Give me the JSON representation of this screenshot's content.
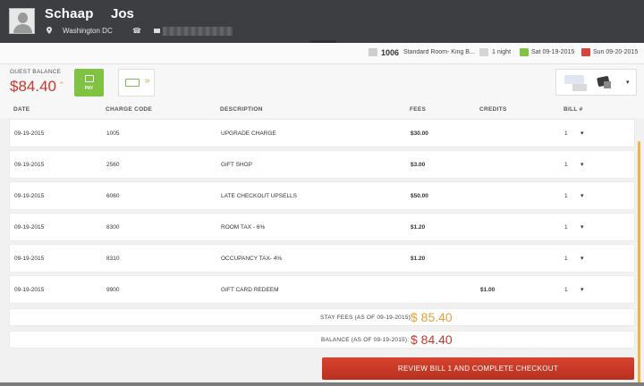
{
  "guest": {
    "first_name": "Schaap",
    "last_name": "Jos",
    "location": "Washington DC"
  },
  "reservation": {
    "room_number": "1006",
    "room_type": "Standard Room- King B...",
    "nights": "1 night",
    "arrival": "Sat 09-19-2015",
    "departure": "Sun 09-20-2015"
  },
  "balance": {
    "label": "GUEST BALANCE",
    "value": "$84.40",
    "pay_label": "PAY"
  },
  "table": {
    "headers": {
      "date": "DATE",
      "charge_code": "CHARGE CODE",
      "description": "DESCRIPTION",
      "fees": "FEES",
      "credits": "CREDITS",
      "bill": "BILL #"
    },
    "rows": [
      {
        "date": "09-19-2015",
        "code": "1005",
        "description": "UPGRADE CHARGE",
        "fees": "$30.00",
        "credits": "",
        "bill": "1"
      },
      {
        "date": "09-19-2015",
        "code": "2560",
        "description": "GIFT SHOP",
        "fees": "$3.00",
        "credits": "",
        "bill": "1"
      },
      {
        "date": "09-19-2015",
        "code": "6060",
        "description": "LATE CHECKOUT UPSELLS",
        "fees": "$50.00",
        "credits": "",
        "bill": "1"
      },
      {
        "date": "09-19-2015",
        "code": "8300",
        "description": "ROOM TAX - 6%",
        "fees": "$1.20",
        "credits": "",
        "bill": "1"
      },
      {
        "date": "09-19-2015",
        "code": "8310",
        "description": "OCCUPANCY TAX- 4%",
        "fees": "$1.20",
        "credits": "",
        "bill": "1"
      },
      {
        "date": "09-19-2015",
        "code": "9900",
        "description": "GIFT CARD REDEEM",
        "fees": "",
        "credits": "$1.00",
        "bill": "1"
      }
    ]
  },
  "totals": {
    "stay_fees_label": "STAY FEES (AS OF 09-19-2015):",
    "stay_fees_value": "$ 85.40",
    "balance_label": "BALANCE (AS OF 09-19-2015):",
    "balance_value": "$ 84.40"
  },
  "checkout_button": "REVIEW BILL 1 AND COMPLETE CHECKOUT",
  "colors": {
    "header": "#3c3e41",
    "balance_red": "#c7382c",
    "stay_fees_orange": "#e2a23a",
    "pay_green": "#80c342",
    "checkout_red": "#c83a26"
  }
}
